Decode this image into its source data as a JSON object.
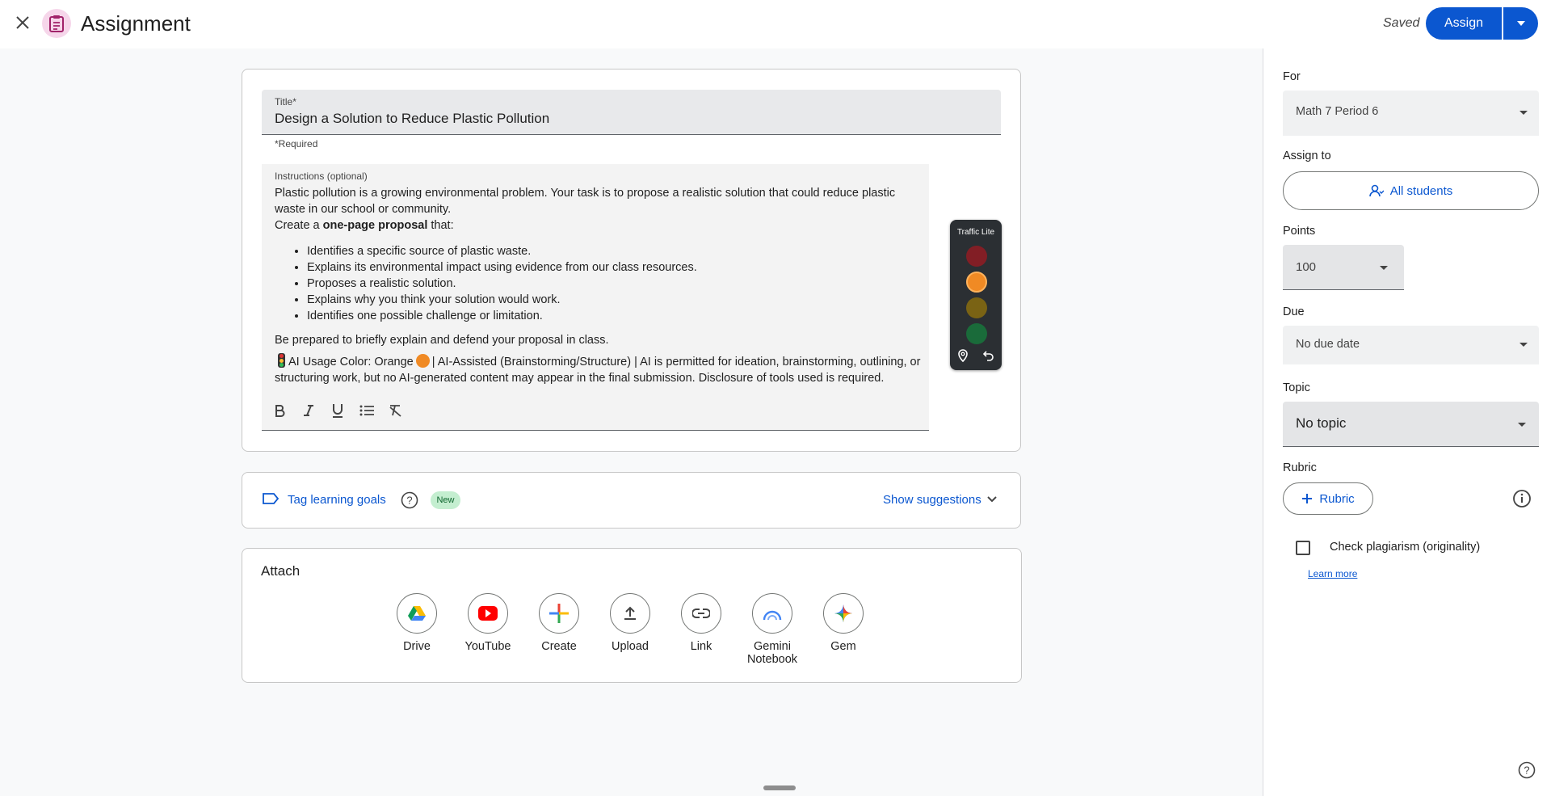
{
  "header": {
    "title": "Assignment",
    "saved_label": "Saved",
    "assign_label": "Assign"
  },
  "form": {
    "title_label": "Title*",
    "title_value": "Design a Solution to Reduce Plastic Pollution",
    "required_note": "*Required",
    "instructions_label": "Instructions (optional)",
    "instructions": {
      "para1": "Plastic pollution is a growing environmental problem. Your task is to propose a realistic solution that could reduce plastic waste in our school or community.",
      "para2_prefix": "Create a ",
      "para2_bold": "one-page proposal",
      "para2_suffix": " that:",
      "bullets": [
        "Identifies a specific source of plastic waste.",
        "Explains its environmental impact using evidence from our class resources.",
        "Proposes a realistic solution.",
        "Explains why you think your solution would work.",
        "Identifies one possible challenge or limitation."
      ],
      "para3": "Be prepared to briefly explain and defend your proposal in class.",
      "ai_prefix": "AI Usage Color: Orange",
      "ai_suffix": "| AI-Assisted (Brainstorming/Structure) | AI is permitted for ideation, brainstorming, outlining, or structuring work, but no AI-generated content may appear in the final submission. Disclosure of tools used is required."
    }
  },
  "traffic_lite": {
    "title": "Traffic Lite",
    "lights": [
      "#b3261e",
      "#f08a24",
      "#8a6d1c",
      "#1e6e3a"
    ]
  },
  "goals": {
    "tag_label": "Tag learning goals",
    "new_badge": "New",
    "show_suggestions": "Show suggestions"
  },
  "attach": {
    "title": "Attach",
    "items": [
      "Drive",
      "YouTube",
      "Create",
      "Upload",
      "Link",
      "Gemini Notebook",
      "Gem"
    ]
  },
  "panel": {
    "for_label": "For",
    "for_value": "Math 7 Period 6",
    "assign_to_label": "Assign to",
    "all_students": "All students",
    "points_label": "Points",
    "points_value": "100",
    "due_label": "Due",
    "due_value": "No due date",
    "topic_label": "Topic",
    "topic_value": "No topic",
    "rubric_label": "Rubric",
    "rubric_button": "Rubric",
    "plagiarism_label": "Check plagiarism (originality)",
    "learn_more": "Learn more"
  },
  "colors": {
    "accent": "#0b57d0",
    "badge_bg": "#c4eed0"
  }
}
